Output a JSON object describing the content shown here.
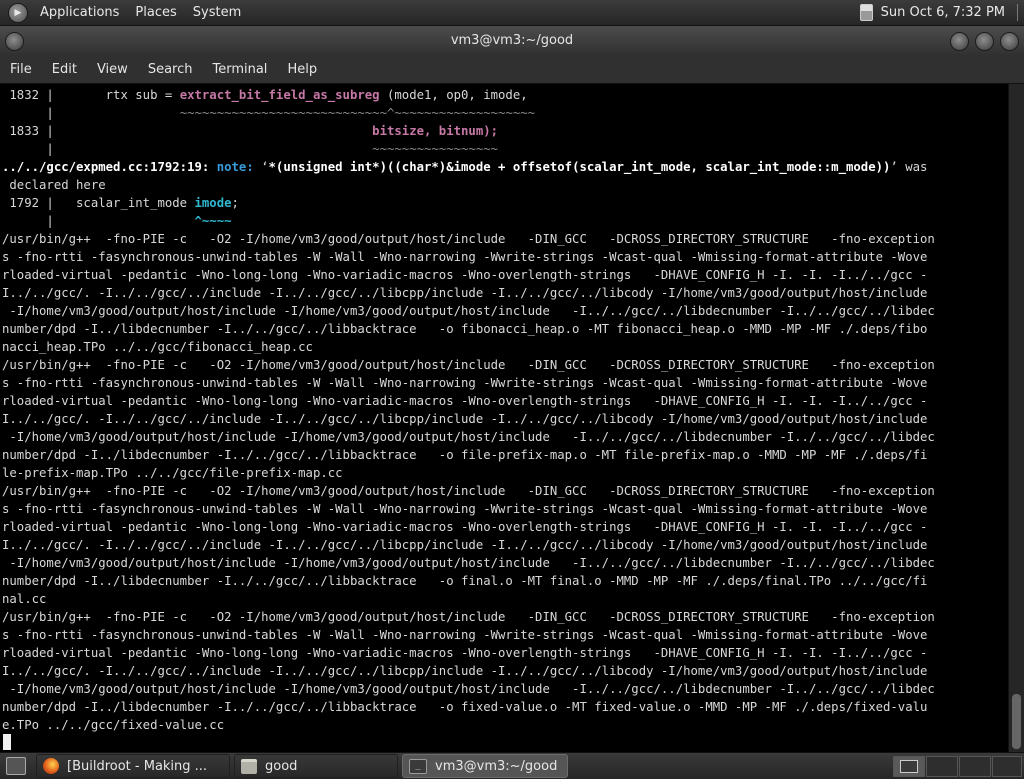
{
  "top_panel": {
    "menus": [
      "Applications",
      "Places",
      "System"
    ],
    "clock": "Sun Oct  6,  7:32 PM"
  },
  "window": {
    "title": "vm3@vm3:~/good"
  },
  "menubar": [
    "File",
    "Edit",
    "View",
    "Search",
    "Terminal",
    "Help"
  ],
  "terminal": {
    "lines": [
      [
        [
          "",
          " 1832 |       rtx sub = "
        ],
        [
          "fn",
          "extract_bit_field_as_subreg"
        ],
        [
          "",
          " (mode1, op0, imode,"
        ]
      ],
      [
        [
          "",
          "      |                 "
        ],
        [
          "dim",
          "~~~~~~~~~~~~~~~~~~~~~~~~~~~~^~~~~~~~~~~~~~~~~~~~"
        ]
      ],
      [
        [
          "",
          " 1833 |                                           "
        ],
        [
          "fn",
          "bitsize, bitnum);"
        ]
      ],
      [
        [
          "",
          "      |                                           "
        ],
        [
          "dim",
          "~~~~~~~~~~~~~~~~~"
        ]
      ],
      [
        [
          "bold",
          "../../gcc/expmed.cc:1792:19: "
        ],
        [
          "note",
          "note: "
        ],
        [
          "",
          "‘"
        ],
        [
          "bold",
          "*(unsigned int*)((char*)&imode + offsetof(scalar_int_mode, scalar_int_mode::m_mode))"
        ],
        [
          "",
          "’ was"
        ]
      ],
      [
        [
          "",
          " declared here"
        ]
      ],
      [
        [
          "",
          " 1792 |   scalar_int_mode "
        ],
        [
          "cyan",
          "imode"
        ],
        [
          "",
          ";"
        ]
      ],
      [
        [
          "",
          "      |                   "
        ],
        [
          "cyan",
          "^~~~~"
        ]
      ],
      [
        [
          "",
          "/usr/bin/g++  -fno-PIE -c   -O2 -I/home/vm3/good/output/host/include   -DIN_GCC   -DCROSS_DIRECTORY_STRUCTURE   -fno-exception"
        ]
      ],
      [
        [
          "",
          "s -fno-rtti -fasynchronous-unwind-tables -W -Wall -Wno-narrowing -Wwrite-strings -Wcast-qual -Wmissing-format-attribute -Wove"
        ]
      ],
      [
        [
          "",
          "rloaded-virtual -pedantic -Wno-long-long -Wno-variadic-macros -Wno-overlength-strings   -DHAVE_CONFIG_H -I. -I. -I../../gcc -"
        ]
      ],
      [
        [
          "",
          "I../../gcc/. -I../../gcc/../include -I../../gcc/../libcpp/include -I../../gcc/../libcody -I/home/vm3/good/output/host/include"
        ]
      ],
      [
        [
          "",
          " -I/home/vm3/good/output/host/include -I/home/vm3/good/output/host/include   -I../../gcc/../libdecnumber -I../../gcc/../libdec"
        ]
      ],
      [
        [
          "",
          "number/dpd -I../libdecnumber -I../../gcc/../libbacktrace   -o fibonacci_heap.o -MT fibonacci_heap.o -MMD -MP -MF ./.deps/fibo"
        ]
      ],
      [
        [
          "",
          "nacci_heap.TPo ../../gcc/fibonacci_heap.cc"
        ]
      ],
      [
        [
          "",
          "/usr/bin/g++  -fno-PIE -c   -O2 -I/home/vm3/good/output/host/include   -DIN_GCC   -DCROSS_DIRECTORY_STRUCTURE   -fno-exception"
        ]
      ],
      [
        [
          "",
          "s -fno-rtti -fasynchronous-unwind-tables -W -Wall -Wno-narrowing -Wwrite-strings -Wcast-qual -Wmissing-format-attribute -Wove"
        ]
      ],
      [
        [
          "",
          "rloaded-virtual -pedantic -Wno-long-long -Wno-variadic-macros -Wno-overlength-strings   -DHAVE_CONFIG_H -I. -I. -I../../gcc -"
        ]
      ],
      [
        [
          "",
          "I../../gcc/. -I../../gcc/../include -I../../gcc/../libcpp/include -I../../gcc/../libcody -I/home/vm3/good/output/host/include"
        ]
      ],
      [
        [
          "",
          " -I/home/vm3/good/output/host/include -I/home/vm3/good/output/host/include   -I../../gcc/../libdecnumber -I../../gcc/../libdec"
        ]
      ],
      [
        [
          "",
          "number/dpd -I../libdecnumber -I../../gcc/../libbacktrace   -o file-prefix-map.o -MT file-prefix-map.o -MMD -MP -MF ./.deps/fi"
        ]
      ],
      [
        [
          "",
          "le-prefix-map.TPo ../../gcc/file-prefix-map.cc"
        ]
      ],
      [
        [
          "",
          "/usr/bin/g++  -fno-PIE -c   -O2 -I/home/vm3/good/output/host/include   -DIN_GCC   -DCROSS_DIRECTORY_STRUCTURE   -fno-exception"
        ]
      ],
      [
        [
          "",
          "s -fno-rtti -fasynchronous-unwind-tables -W -Wall -Wno-narrowing -Wwrite-strings -Wcast-qual -Wmissing-format-attribute -Wove"
        ]
      ],
      [
        [
          "",
          "rloaded-virtual -pedantic -Wno-long-long -Wno-variadic-macros -Wno-overlength-strings   -DHAVE_CONFIG_H -I. -I. -I../../gcc -"
        ]
      ],
      [
        [
          "",
          "I../../gcc/. -I../../gcc/../include -I../../gcc/../libcpp/include -I../../gcc/../libcody -I/home/vm3/good/output/host/include"
        ]
      ],
      [
        [
          "",
          " -I/home/vm3/good/output/host/include -I/home/vm3/good/output/host/include   -I../../gcc/../libdecnumber -I../../gcc/../libdec"
        ]
      ],
      [
        [
          "",
          "number/dpd -I../libdecnumber -I../../gcc/../libbacktrace   -o final.o -MT final.o -MMD -MP -MF ./.deps/final.TPo ../../gcc/fi"
        ]
      ],
      [
        [
          "",
          "nal.cc"
        ]
      ],
      [
        [
          "",
          "/usr/bin/g++  -fno-PIE -c   -O2 -I/home/vm3/good/output/host/include   -DIN_GCC   -DCROSS_DIRECTORY_STRUCTURE   -fno-exception"
        ]
      ],
      [
        [
          "",
          "s -fno-rtti -fasynchronous-unwind-tables -W -Wall -Wno-narrowing -Wwrite-strings -Wcast-qual -Wmissing-format-attribute -Wove"
        ]
      ],
      [
        [
          "",
          "rloaded-virtual -pedantic -Wno-long-long -Wno-variadic-macros -Wno-overlength-strings   -DHAVE_CONFIG_H -I. -I. -I../../gcc -"
        ]
      ],
      [
        [
          "",
          "I../../gcc/. -I../../gcc/../include -I../../gcc/../libcpp/include -I../../gcc/../libcody -I/home/vm3/good/output/host/include"
        ]
      ],
      [
        [
          "",
          " -I/home/vm3/good/output/host/include -I/home/vm3/good/output/host/include   -I../../gcc/../libdecnumber -I../../gcc/../libdec"
        ]
      ],
      [
        [
          "",
          "number/dpd -I../libdecnumber -I../../gcc/../libbacktrace   -o fixed-value.o -MT fixed-value.o -MMD -MP -MF ./.deps/fixed-valu"
        ]
      ],
      [
        [
          "",
          "e.TPo ../../gcc/fixed-value.cc"
        ]
      ]
    ]
  },
  "taskbar": {
    "tasks": [
      {
        "label": "[Buildroot - Making ...",
        "icon": "firefox-icon"
      },
      {
        "label": "good",
        "icon": "folder-icon"
      },
      {
        "label": "vm3@vm3:~/good",
        "icon": "terminal-icon"
      }
    ]
  }
}
